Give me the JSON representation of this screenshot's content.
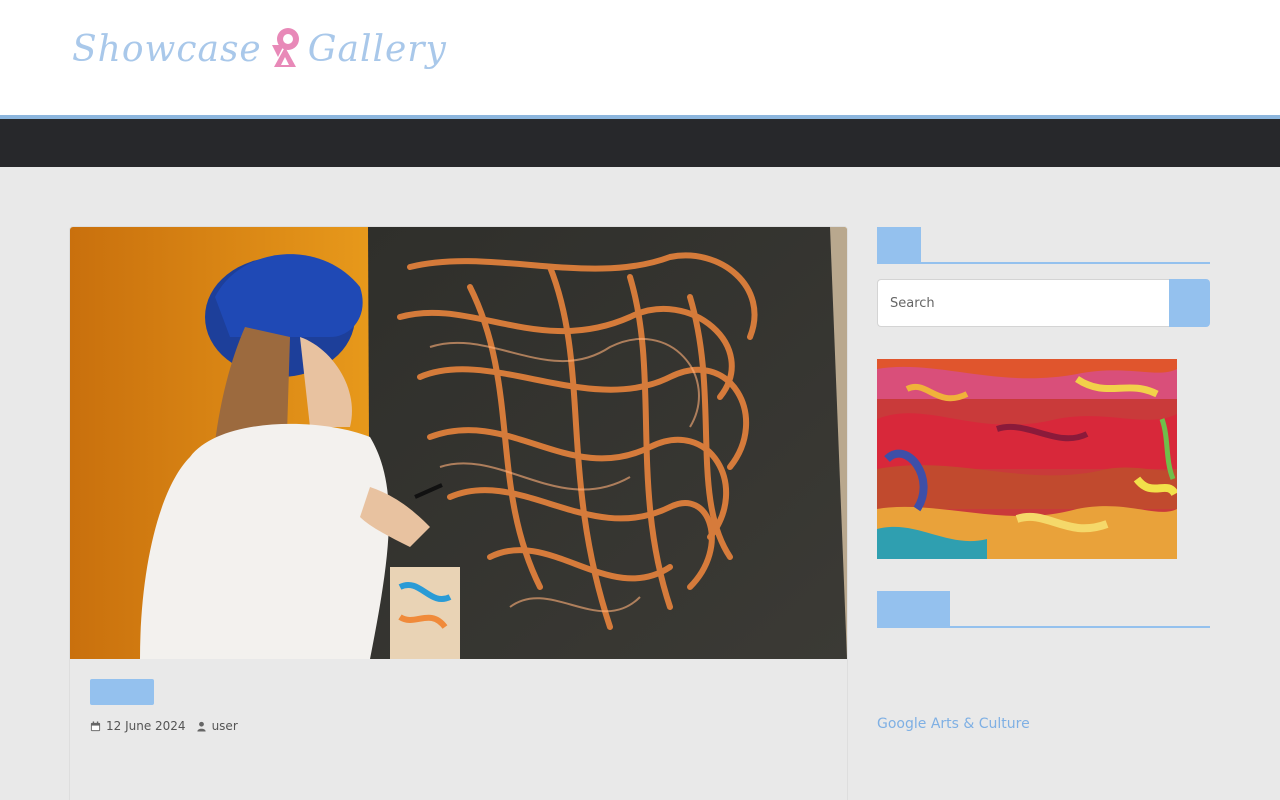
{
  "header": {
    "logo_left_word": "Showcase",
    "logo_right_word": "Gallery",
    "accent_color": "#8cb6de",
    "nav_bg_color": "#27282b"
  },
  "post": {
    "image_icon": "artwork-photo-child-painting",
    "date": "12 June 2024",
    "author": "user",
    "date_icon": "calendar-icon",
    "author_icon": "user-icon"
  },
  "sidebar": {
    "search": {
      "placeholder": "Search",
      "button_icon": "search-icon"
    },
    "image_icon": "abstract-painting",
    "link_text": "Google Arts & Culture"
  },
  "colors": {
    "brand_blue": "#94c1ee",
    "page_bg": "#e9e9e9",
    "link": "#7fb0e4"
  }
}
